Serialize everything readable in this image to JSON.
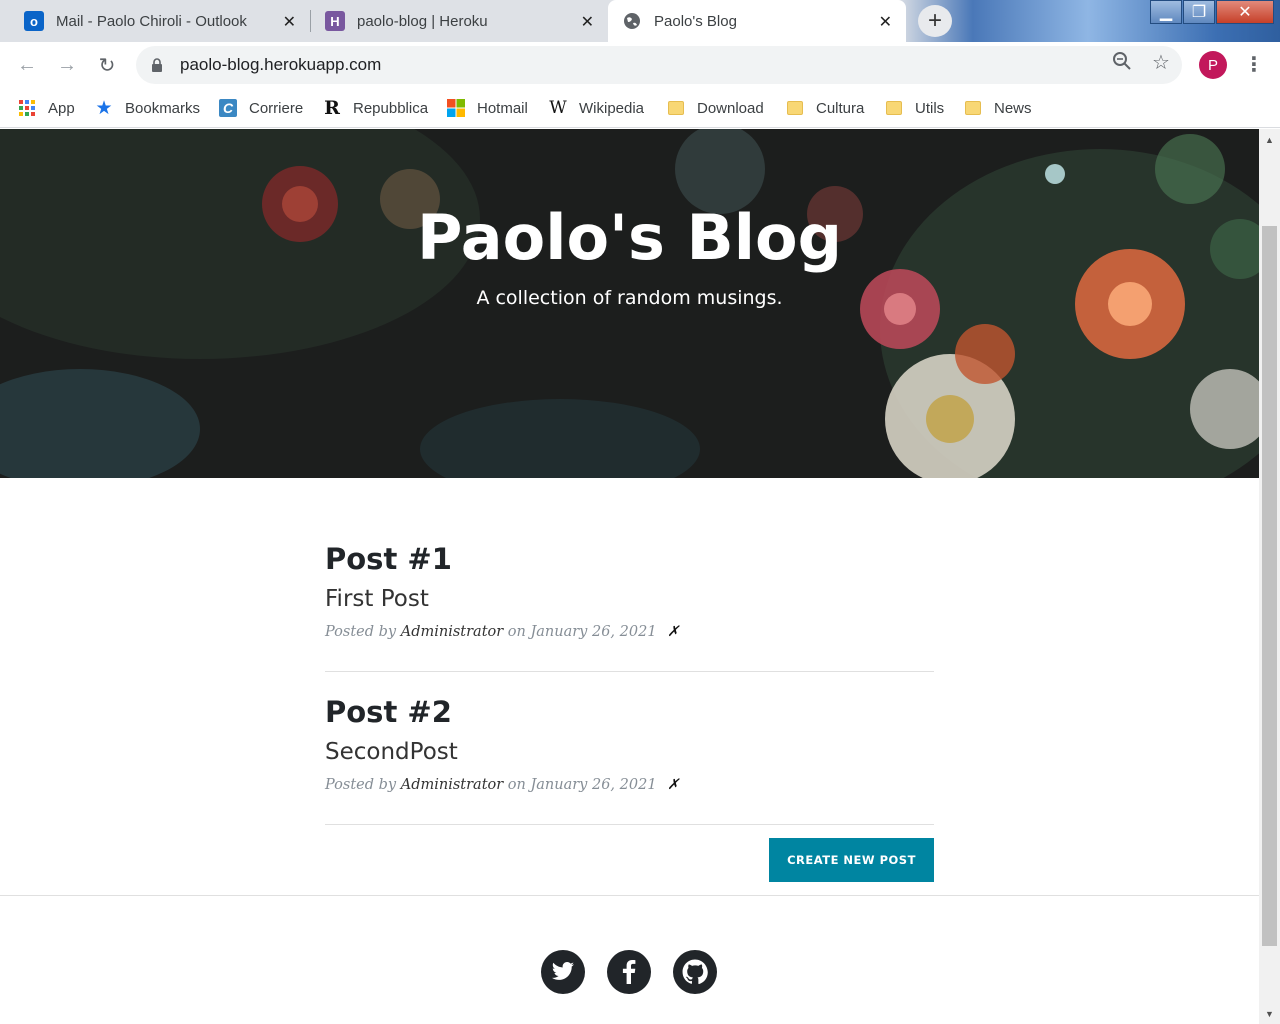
{
  "tabs": [
    {
      "title": "Mail - Paolo Chiroli - Outlook",
      "icon": "outlook-icon"
    },
    {
      "title": "paolo-blog | Heroku",
      "icon": "heroku-icon"
    },
    {
      "title": "Paolo's Blog",
      "icon": "globe-icon",
      "active": true
    }
  ],
  "address": {
    "url": "paolo-blog.herokuapp.com"
  },
  "profile": {
    "initial": "P",
    "color": "#c2185b"
  },
  "bookmarks": [
    {
      "label": "App",
      "icon": "apps-grid-icon"
    },
    {
      "label": "Bookmarks",
      "icon": "star-icon"
    },
    {
      "label": "Corriere",
      "icon": "corriere-icon"
    },
    {
      "label": "Repubblica",
      "icon": "repubblica-icon"
    },
    {
      "label": "Hotmail",
      "icon": "microsoft-icon"
    },
    {
      "label": "Wikipedia",
      "icon": "wikipedia-icon"
    },
    {
      "label": "Download",
      "icon": "folder-icon"
    },
    {
      "label": "Cultura",
      "icon": "folder-icon"
    },
    {
      "label": "Utils",
      "icon": "folder-icon"
    },
    {
      "label": "News",
      "icon": "folder-icon"
    }
  ],
  "hero": {
    "title": "Paolo's Blog",
    "subtitle": "A collection of random musings."
  },
  "posts": [
    {
      "title": "Post #1",
      "subtitle": "First Post",
      "posted_by": "Posted by",
      "author": "Administrator",
      "on": "on January 26, 2021",
      "delete": "✗"
    },
    {
      "title": "Post #2",
      "subtitle": "SecondPost",
      "posted_by": "Posted by",
      "author": "Administrator",
      "on": "on January 26, 2021",
      "delete": "✗"
    }
  ],
  "actions": {
    "create_post": "CREATE NEW POST"
  },
  "footer": {
    "social": [
      {
        "icon": "twitter-icon"
      },
      {
        "icon": "facebook-icon"
      },
      {
        "icon": "github-icon"
      }
    ]
  },
  "colors": {
    "accent": "#0085a1",
    "text": "#212529",
    "meta": "#868e96"
  }
}
